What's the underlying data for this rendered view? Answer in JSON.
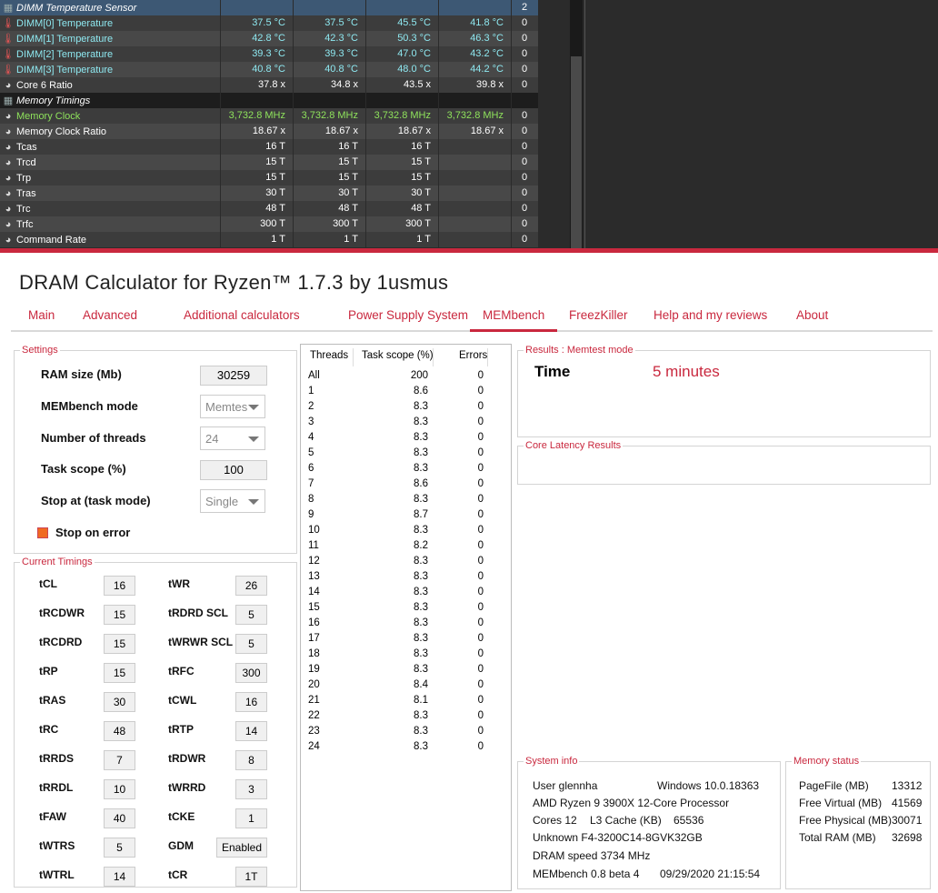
{
  "hwinfo": {
    "rows": [
      {
        "icon": "chip",
        "name": "DIMM Temperature Sensor",
        "v1": "",
        "v2": "",
        "v3": "",
        "v4": "",
        "count": "2",
        "group": true,
        "first": true,
        "color": ""
      },
      {
        "icon": "therm",
        "name": "DIMM[0] Temperature",
        "v1": "37.5 °C",
        "v2": "37.5 °C",
        "v3": "45.5 °C",
        "v4": "41.8 °C",
        "count": "0",
        "color": "cyan"
      },
      {
        "icon": "therm",
        "name": "DIMM[1] Temperature",
        "v1": "42.8 °C",
        "v2": "42.3 °C",
        "v3": "50.3 °C",
        "v4": "46.3 °C",
        "count": "0",
        "color": "cyan"
      },
      {
        "icon": "therm",
        "name": "DIMM[2] Temperature",
        "v1": "39.3 °C",
        "v2": "39.3 °C",
        "v3": "47.0 °C",
        "v4": "43.2 °C",
        "count": "0",
        "color": "cyan"
      },
      {
        "icon": "therm",
        "name": "DIMM[3] Temperature",
        "v1": "40.8 °C",
        "v2": "40.8 °C",
        "v3": "48.0 °C",
        "v4": "44.2 °C",
        "count": "0",
        "color": "cyan"
      },
      {
        "icon": "gauge",
        "name": "Core 6 Ratio",
        "v1": "37.8 x",
        "v2": "34.8 x",
        "v3": "43.5 x",
        "v4": "39.8 x",
        "count": "0",
        "color": ""
      },
      {
        "icon": "chip",
        "name": "Memory Timings",
        "v1": "",
        "v2": "",
        "v3": "",
        "v4": "",
        "count": "",
        "group": true,
        "color": ""
      },
      {
        "icon": "gauge",
        "name": "Memory Clock",
        "v1": "3,732.8 MHz",
        "v2": "3,732.8 MHz",
        "v3": "3,732.8 MHz",
        "v4": "3,732.8 MHz",
        "count": "0",
        "color": "green"
      },
      {
        "icon": "gauge",
        "name": "Memory Clock Ratio",
        "v1": "18.67 x",
        "v2": "18.67 x",
        "v3": "18.67 x",
        "v4": "18.67 x",
        "count": "0",
        "color": ""
      },
      {
        "icon": "gauge",
        "name": "Tcas",
        "v1": "16 T",
        "v2": "16 T",
        "v3": "16 T",
        "v4": "",
        "count": "0",
        "color": ""
      },
      {
        "icon": "gauge",
        "name": "Trcd",
        "v1": "15 T",
        "v2": "15 T",
        "v3": "15 T",
        "v4": "",
        "count": "0",
        "color": ""
      },
      {
        "icon": "gauge",
        "name": "Trp",
        "v1": "15 T",
        "v2": "15 T",
        "v3": "15 T",
        "v4": "",
        "count": "0",
        "color": ""
      },
      {
        "icon": "gauge",
        "name": "Tras",
        "v1": "30 T",
        "v2": "30 T",
        "v3": "30 T",
        "v4": "",
        "count": "0",
        "color": ""
      },
      {
        "icon": "gauge",
        "name": "Trc",
        "v1": "48 T",
        "v2": "48 T",
        "v3": "48 T",
        "v4": "",
        "count": "0",
        "color": ""
      },
      {
        "icon": "gauge",
        "name": "Trfc",
        "v1": "300 T",
        "v2": "300 T",
        "v3": "300 T",
        "v4": "",
        "count": "0",
        "color": ""
      },
      {
        "icon": "gauge",
        "name": "Command Rate",
        "v1": "1 T",
        "v2": "1 T",
        "v3": "1 T",
        "v4": "",
        "count": "0",
        "color": ""
      }
    ]
  },
  "app": {
    "title": "DRAM Calculator for Ryzen™ 1.7.3 by 1usmus",
    "tabs": [
      "Main",
      "Advanced",
      "Additional calculators",
      "Power Supply System",
      "MEMbench",
      "FreezKiller",
      "Help and my reviews",
      "About"
    ],
    "active_tab": "MEMbench"
  },
  "settings": {
    "legend": "Settings",
    "ram_size_label": "RAM size (Mb)",
    "ram_size_value": "30259",
    "mode_label": "MEMbench mode",
    "mode_value": "Memtes",
    "threads_label": "Number of threads",
    "threads_value": "24",
    "scope_label": "Task scope (%)",
    "scope_value": "100",
    "stop_label": "Stop at (task mode)",
    "stop_value": "Single",
    "stop_on_error_label": "Stop on error"
  },
  "timings": {
    "legend": "Current Timings",
    "left": [
      {
        "label": "tCL",
        "value": "16"
      },
      {
        "label": "tRCDWR",
        "value": "15"
      },
      {
        "label": "tRCDRD",
        "value": "15"
      },
      {
        "label": "tRP",
        "value": "15"
      },
      {
        "label": "tRAS",
        "value": "30"
      },
      {
        "label": "tRC",
        "value": "48"
      },
      {
        "label": "tRRDS",
        "value": "7"
      },
      {
        "label": "tRRDL",
        "value": "10"
      },
      {
        "label": "tFAW",
        "value": "40"
      },
      {
        "label": "tWTRS",
        "value": "5"
      },
      {
        "label": "tWTRL",
        "value": "14"
      }
    ],
    "right": [
      {
        "label": "tWR",
        "value": "26"
      },
      {
        "label": "tRDRD SCL",
        "value": "5"
      },
      {
        "label": "tWRWR SCL",
        "value": "5"
      },
      {
        "label": "tRFC",
        "value": "300"
      },
      {
        "label": "tCWL",
        "value": "16"
      },
      {
        "label": "tRTP",
        "value": "14"
      },
      {
        "label": "tRDWR",
        "value": "8"
      },
      {
        "label": "tWRRD",
        "value": "3"
      },
      {
        "label": "tCKE",
        "value": "1"
      },
      {
        "label": "GDM",
        "value": "Enabled"
      },
      {
        "label": "tCR",
        "value": "1T"
      }
    ]
  },
  "threads_table": {
    "headers": [
      "Threads",
      "Task scope (%)",
      "Errors"
    ],
    "rows": [
      [
        "All",
        "200",
        "0"
      ],
      [
        "1",
        "8.6",
        "0"
      ],
      [
        "2",
        "8.3",
        "0"
      ],
      [
        "3",
        "8.3",
        "0"
      ],
      [
        "4",
        "8.3",
        "0"
      ],
      [
        "5",
        "8.3",
        "0"
      ],
      [
        "6",
        "8.3",
        "0"
      ],
      [
        "7",
        "8.6",
        "0"
      ],
      [
        "8",
        "8.3",
        "0"
      ],
      [
        "9",
        "8.7",
        "0"
      ],
      [
        "10",
        "8.3",
        "0"
      ],
      [
        "11",
        "8.2",
        "0"
      ],
      [
        "12",
        "8.3",
        "0"
      ],
      [
        "13",
        "8.3",
        "0"
      ],
      [
        "14",
        "8.3",
        "0"
      ],
      [
        "15",
        "8.3",
        "0"
      ],
      [
        "16",
        "8.3",
        "0"
      ],
      [
        "17",
        "8.3",
        "0"
      ],
      [
        "18",
        "8.3",
        "0"
      ],
      [
        "19",
        "8.3",
        "0"
      ],
      [
        "20",
        "8.4",
        "0"
      ],
      [
        "21",
        "8.1",
        "0"
      ],
      [
        "22",
        "8.3",
        "0"
      ],
      [
        "23",
        "8.3",
        "0"
      ],
      [
        "24",
        "8.3",
        "0"
      ]
    ]
  },
  "results": {
    "legend": "Results : Memtest mode",
    "time_label": "Time",
    "time_value": "5 minutes",
    "latency_legend": "Core Latency Results"
  },
  "system_info": {
    "legend": "System info",
    "user": "User glennha",
    "os": "Windows 10.0.18363",
    "cpu": "AMD Ryzen 9 3900X 12-Core Processor",
    "cores": "Cores 12",
    "l3": "L3 Cache (KB)",
    "l3_value": "65536",
    "memory": "Unknown F4-3200C14-8GVK32GB",
    "dram_speed": "DRAM speed 3734 MHz",
    "version": "MEMbench 0.8 beta 4",
    "datetime": "09/29/2020 21:15:54"
  },
  "memory_status": {
    "legend": "Memory status",
    "rows": [
      {
        "label": "PageFile (MB)",
        "value": "13312"
      },
      {
        "label": "Free Virtual (MB)",
        "value": "41569"
      },
      {
        "label": "Free Physical (MB)",
        "value": "30071"
      },
      {
        "label": "Total RAM (MB)",
        "value": "32698"
      }
    ]
  },
  "colors": {
    "accent": "#c9283e",
    "hw_bg": "#2b2b2b",
    "hw_cyan": "#8ee8f0",
    "hw_green": "#8fe35c",
    "checkbox": "#f06a22"
  }
}
